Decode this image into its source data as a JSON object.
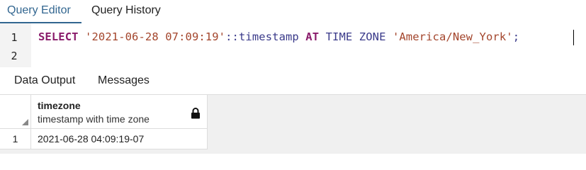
{
  "tabs": [
    {
      "label": "Query Editor",
      "active": true
    },
    {
      "label": "Query History",
      "active": false
    }
  ],
  "editor": {
    "line_numbers": [
      "1",
      "2"
    ],
    "tokens": {
      "select": "SELECT",
      "literal": "'2021-06-28 07:09:19'",
      "cast": "::timestamp",
      "at": "AT",
      "time_zone": "TIME ZONE",
      "zone_literal": "'America/New_York'",
      "semicolon": ";"
    }
  },
  "result_tabs": [
    {
      "label": "Data Output",
      "active": true
    },
    {
      "label": "Messages",
      "active": false
    }
  ],
  "grid": {
    "columns": [
      {
        "name": "timezone",
        "type": "timestamp with time zone",
        "icon": "lock-icon"
      }
    ],
    "rows": [
      {
        "num": "1",
        "cells": [
          "2021-06-28 04:09:19-07"
        ]
      }
    ]
  },
  "colors": {
    "active_tab": "#326690",
    "keyword": "#8a1c6b",
    "string": "#a3452c"
  }
}
